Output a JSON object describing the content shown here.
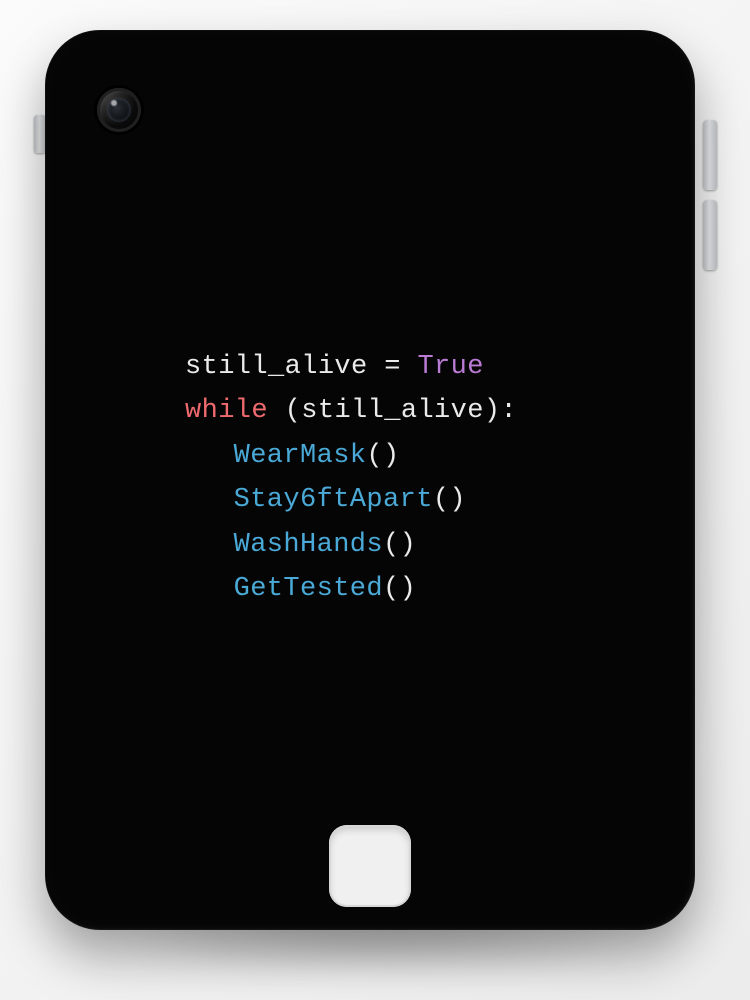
{
  "code": {
    "line1": {
      "var": "still_alive",
      "op": " = ",
      "const": "True"
    },
    "line2": {
      "kw": "while",
      "sp": " ",
      "open": "(",
      "cond": "still_alive",
      "close": ")",
      "colon": ":"
    },
    "calls": {
      "a": {
        "name": "WearMask",
        "paren": "()"
      },
      "b": {
        "name": "Stay6ftApart",
        "paren": "()"
      },
      "c": {
        "name": "WashHands",
        "paren": "()"
      },
      "d": {
        "name": "GetTested",
        "paren": "()"
      }
    }
  }
}
